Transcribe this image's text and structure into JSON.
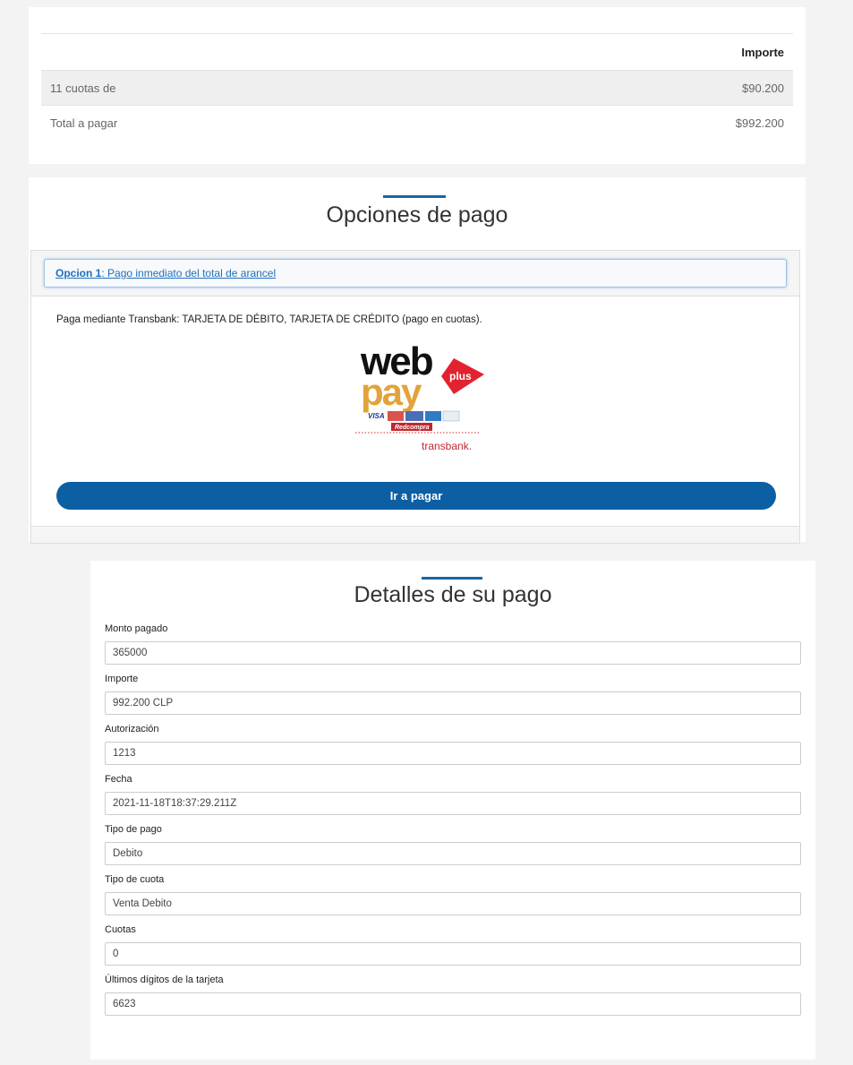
{
  "summary": {
    "header_importe": "Importe",
    "rows": [
      {
        "label": "11 cuotas de",
        "value": "$90.200"
      },
      {
        "label": "Total a pagar",
        "value": "$992.200"
      }
    ]
  },
  "options": {
    "title": "Opciones de pago",
    "option1_prefix": "Opcion 1",
    "option1_text": ": Pago inmediato del total de arancel",
    "description": "Paga mediante Transbank: TARJETA DE DÉBITO, TARJETA DE CRÉDITO (pago en cuotas).",
    "logo": {
      "web": "web",
      "pay": "pay",
      "plus": "plus",
      "visa": "VISA",
      "redcompra": "Redcompra",
      "transbank": "transbank."
    },
    "pay_button": "Ir a pagar"
  },
  "details": {
    "title": "Detalles de su pago",
    "fields": [
      {
        "label": "Monto pagado",
        "value": "365000"
      },
      {
        "label": "Importe",
        "value": "992.200 CLP"
      },
      {
        "label": "Autorización",
        "value": "1213"
      },
      {
        "label": "Fecha",
        "value": "2021-11-18T18:37:29.211Z"
      },
      {
        "label": "Tipo de pago",
        "value": "Debito"
      },
      {
        "label": "Tipo de cuota",
        "value": "Venta Debito"
      },
      {
        "label": "Cuotas",
        "value": "0"
      },
      {
        "label": "Últimos dígitos de la tarjeta",
        "value": "6623"
      }
    ]
  },
  "colors": {
    "accent": "#1866a6",
    "button": "#0c5fa3",
    "webpay_red": "#e3222f",
    "webpay_yellow": "#e2a33a"
  }
}
